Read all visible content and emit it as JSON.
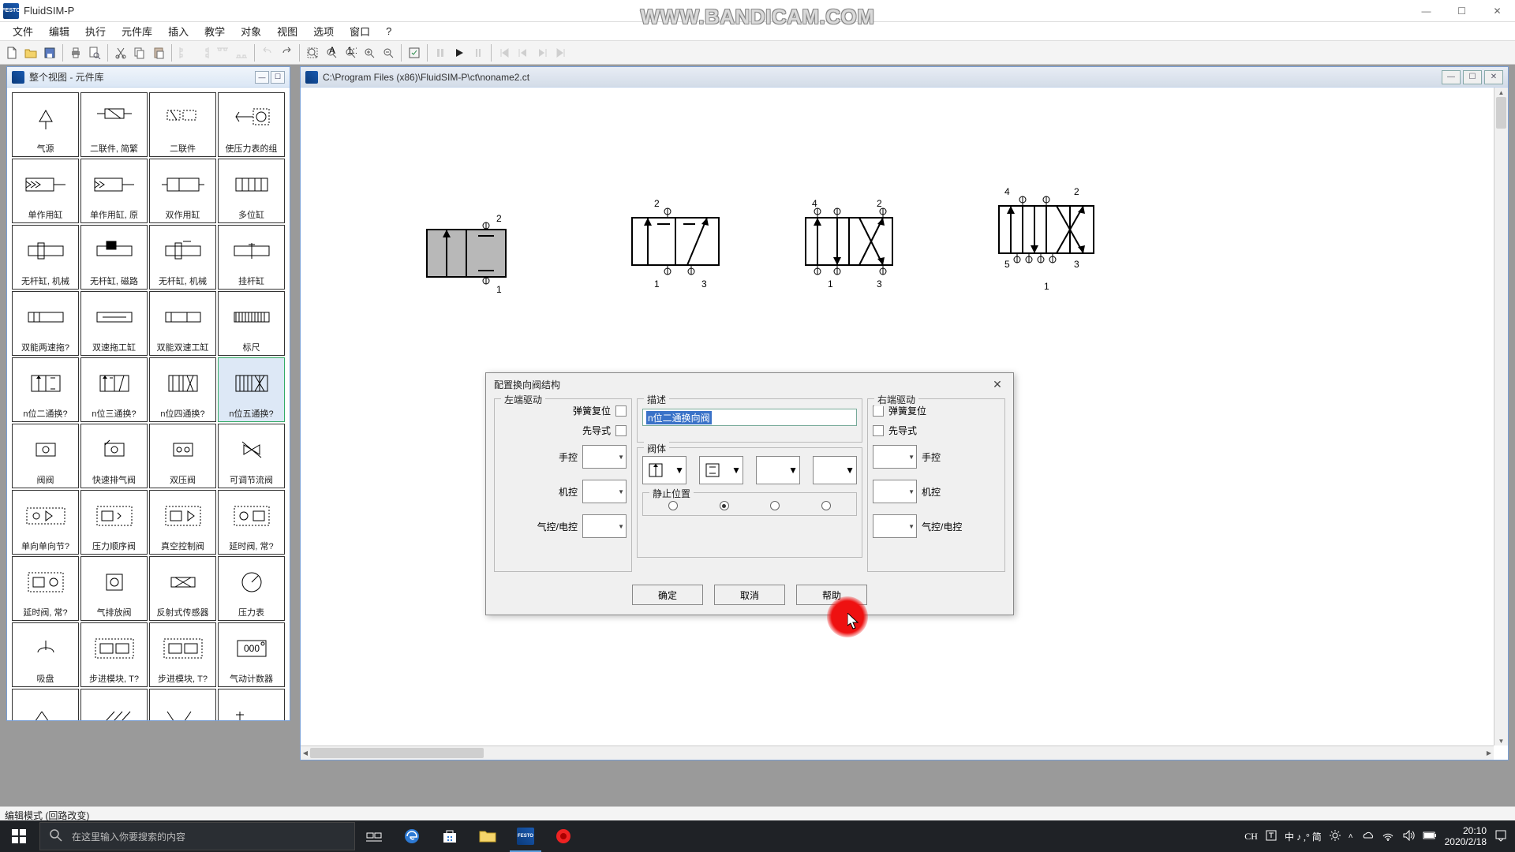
{
  "app": {
    "title": "FluidSIM-P"
  },
  "watermark": "WWW.BANDICAM.COM",
  "menu": [
    "文件",
    "编辑",
    "执行",
    "元件库",
    "插入",
    "教学",
    "对象",
    "视图",
    "选项",
    "窗口",
    "?"
  ],
  "library": {
    "title": "整个视图 - 元件库",
    "items": [
      "气源",
      "二联件, 简繁",
      "二联件",
      "使压力表的组",
      "单作用缸",
      "单作用缸, 原",
      "双作用缸",
      "多位缸",
      "无杆缸, 机械",
      "无杆缸, 磁路",
      "无杆缸, 机械",
      "挂杆缸",
      "双能两速拖?",
      "双速拖工缸",
      "双能双速工缸",
      "标尺",
      "n位二通换?",
      "n位三通换?",
      "n位四通换?",
      "n位五通换?",
      "阀阀",
      "快速排气阀",
      "双压阀",
      "可调节流阀",
      "单向单向节?",
      "压力顺序阀",
      "真空控制阀",
      "延时阀, 常?",
      "延时阀, 常?",
      "气排放阀",
      "反射式传感器",
      "压力表",
      "吸盘",
      "步进模块, T?",
      "步进模块, T?",
      "气动计数器",
      "",
      "",
      "",
      ""
    ]
  },
  "canvas": {
    "title": "C:\\Program Files (x86)\\FluidSIM-P\\ct\\noname2.ct",
    "ports": {
      "p1": "1",
      "p2": "2",
      "p3": "3",
      "p4": "4",
      "p5": "5"
    }
  },
  "dialog": {
    "title": "配置换向阀结构",
    "left_group": "左端驱动",
    "right_group": "右端驱动",
    "desc_group": "描述",
    "body_group": "阀体",
    "rest_group": "静止位置",
    "spring_return": "弹簧复位",
    "pilot": "先导式",
    "manual": "手控",
    "mech": "机控",
    "pneu_elec": "气控/电控",
    "desc_value": "n位二通换向阀",
    "ok": "确定",
    "cancel": "取消",
    "help": "帮助"
  },
  "status": "编辑模式 (回路改变)",
  "taskbar": {
    "search_placeholder": "在这里输入你要搜索的内容",
    "ime": "CH",
    "ime2": "中 ♪ ,° 简",
    "time": "20:10",
    "date": "2020/2/18"
  }
}
